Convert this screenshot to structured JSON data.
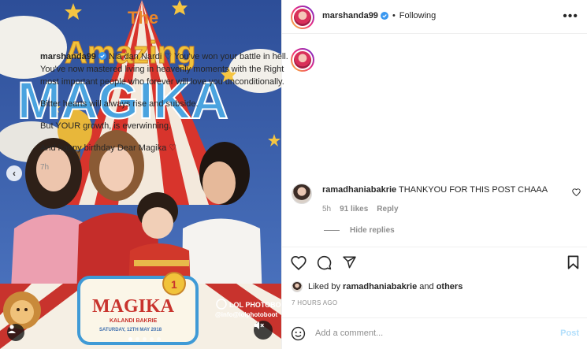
{
  "post": {
    "username": "marshanda99",
    "follow_status": "Following",
    "separator": "•",
    "more_icon": "more-horizontal-icon"
  },
  "media": {
    "banner_top_small": "The",
    "banner_amazing": "Amazing",
    "banner_magika": "MAGIKA",
    "frame_title": "MAGIKA",
    "frame_subtitle": "KALANDI BAKRIE",
    "frame_date": "SATURDAY, 12TH MAY 2018",
    "frame_badge": "1",
    "photobooth_name": "LOL PHOTOBOO",
    "photobooth_handle": "@info@lolphotoboot",
    "slides": 5,
    "active_slide": 1
  },
  "caption": {
    "username": "marshanda99",
    "lines": [
      "Nia dan Nardi ♡ You've won your battle in hell. You've now mastered living in heavenly moments with the Right most important people who forever will love you unconditionally.",
      "Bitter hearts will always rise and subside.",
      "But YOUR growth, is everwinning.",
      "And happy birthday Dear Magika ♡"
    ],
    "time": "7h"
  },
  "comment": {
    "username": "ramadhaniabakrie",
    "text": "THANKYOU FOR THIS POST CHAAA",
    "time": "5h",
    "likes": "91 likes",
    "reply": "Reply",
    "hide_replies": "Hide replies"
  },
  "likes": {
    "prefix": "Liked by",
    "user": "ramadhaniabakrie",
    "and": "and",
    "others": "others"
  },
  "posted": "7 HOURS AGO",
  "add_comment": {
    "placeholder": "Add a comment...",
    "post_label": "Post"
  },
  "colors": {
    "verified": "#3897f0",
    "post_button": "#b2dffc",
    "muted": "#8e8e8e"
  }
}
